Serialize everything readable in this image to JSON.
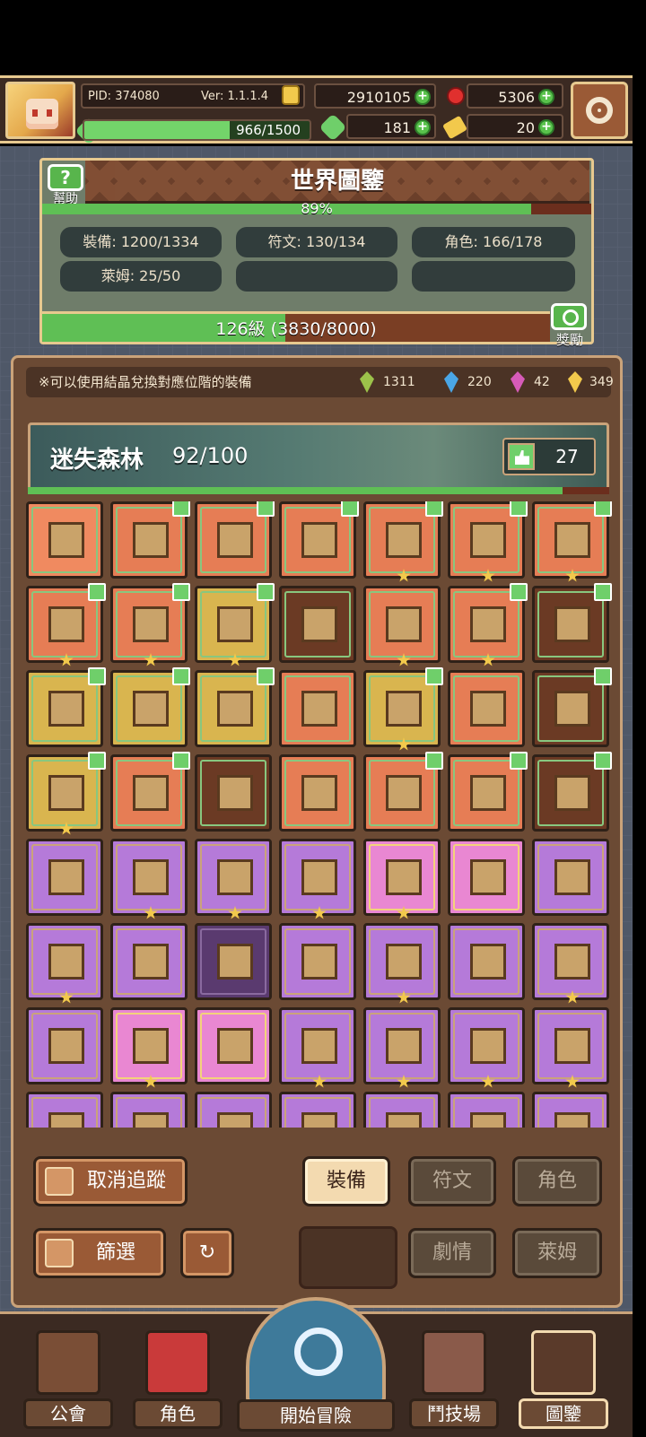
{
  "header": {
    "pid": "PID: 374080",
    "version": "Ver: 1.1.1.4",
    "gold": "2910105",
    "ruby": "5306",
    "exp_text": "966/1500",
    "exp_fraction": 0.644,
    "clover": "181",
    "keys": "20"
  },
  "world": {
    "title": "世界圖鑒",
    "help_label": "幫助",
    "progress_text": "89%",
    "progress": 0.89,
    "stats": {
      "equipment": "裝備: 1200/1334",
      "runes": "符文: 130/134",
      "characters": "角色: 166/178",
      "slime": "萊姆: 25/50"
    },
    "level_text": "126級 (3830/8000)",
    "level_fraction": 0.479,
    "reward_label": "獎勵"
  },
  "collection": {
    "notice": "※可以使用結晶兌換對應位階的裝備",
    "crystals": [
      {
        "color": "#9cc24a",
        "value": "1311"
      },
      {
        "color": "#4aa6e6",
        "value": "220"
      },
      {
        "color": "#d65bb8",
        "value": "42"
      },
      {
        "color": "#f2c94c",
        "value": "349"
      }
    ],
    "area_name": "迷失森林",
    "area_count": "92/100",
    "area_likes": "27",
    "area_progress": 0.92
  },
  "controls": {
    "untrack": "取消追蹤",
    "filter": "篩選",
    "tab_equipment": "裝備",
    "tab_runes": "符文",
    "tab_characters": "角色",
    "tab_story": "劇情",
    "tab_slime": "萊姆"
  },
  "nav": {
    "guild": "公會",
    "character": "角色",
    "adventure": "開始冒險",
    "arena": "鬥技場",
    "codex": "圖鑒"
  }
}
